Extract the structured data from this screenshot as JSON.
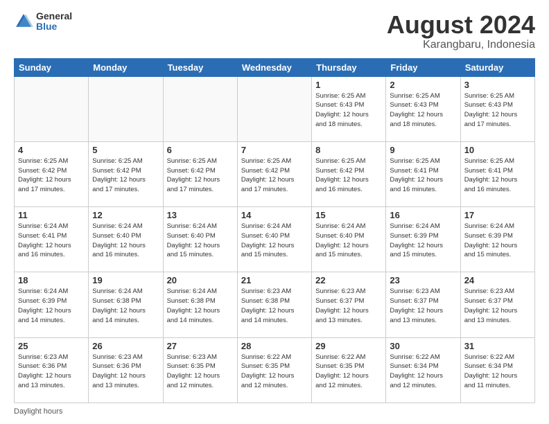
{
  "logo": {
    "line1": "General",
    "line2": "Blue"
  },
  "title": "August 2024",
  "subtitle": "Karangbaru, Indonesia",
  "days_header": [
    "Sunday",
    "Monday",
    "Tuesday",
    "Wednesday",
    "Thursday",
    "Friday",
    "Saturday"
  ],
  "footer": "Daylight hours",
  "weeks": [
    [
      {
        "num": "",
        "info": ""
      },
      {
        "num": "",
        "info": ""
      },
      {
        "num": "",
        "info": ""
      },
      {
        "num": "",
        "info": ""
      },
      {
        "num": "1",
        "info": "Sunrise: 6:25 AM\nSunset: 6:43 PM\nDaylight: 12 hours\nand 18 minutes."
      },
      {
        "num": "2",
        "info": "Sunrise: 6:25 AM\nSunset: 6:43 PM\nDaylight: 12 hours\nand 18 minutes."
      },
      {
        "num": "3",
        "info": "Sunrise: 6:25 AM\nSunset: 6:43 PM\nDaylight: 12 hours\nand 17 minutes."
      }
    ],
    [
      {
        "num": "4",
        "info": "Sunrise: 6:25 AM\nSunset: 6:42 PM\nDaylight: 12 hours\nand 17 minutes."
      },
      {
        "num": "5",
        "info": "Sunrise: 6:25 AM\nSunset: 6:42 PM\nDaylight: 12 hours\nand 17 minutes."
      },
      {
        "num": "6",
        "info": "Sunrise: 6:25 AM\nSunset: 6:42 PM\nDaylight: 12 hours\nand 17 minutes."
      },
      {
        "num": "7",
        "info": "Sunrise: 6:25 AM\nSunset: 6:42 PM\nDaylight: 12 hours\nand 17 minutes."
      },
      {
        "num": "8",
        "info": "Sunrise: 6:25 AM\nSunset: 6:42 PM\nDaylight: 12 hours\nand 16 minutes."
      },
      {
        "num": "9",
        "info": "Sunrise: 6:25 AM\nSunset: 6:41 PM\nDaylight: 12 hours\nand 16 minutes."
      },
      {
        "num": "10",
        "info": "Sunrise: 6:25 AM\nSunset: 6:41 PM\nDaylight: 12 hours\nand 16 minutes."
      }
    ],
    [
      {
        "num": "11",
        "info": "Sunrise: 6:24 AM\nSunset: 6:41 PM\nDaylight: 12 hours\nand 16 minutes."
      },
      {
        "num": "12",
        "info": "Sunrise: 6:24 AM\nSunset: 6:40 PM\nDaylight: 12 hours\nand 16 minutes."
      },
      {
        "num": "13",
        "info": "Sunrise: 6:24 AM\nSunset: 6:40 PM\nDaylight: 12 hours\nand 15 minutes."
      },
      {
        "num": "14",
        "info": "Sunrise: 6:24 AM\nSunset: 6:40 PM\nDaylight: 12 hours\nand 15 minutes."
      },
      {
        "num": "15",
        "info": "Sunrise: 6:24 AM\nSunset: 6:40 PM\nDaylight: 12 hours\nand 15 minutes."
      },
      {
        "num": "16",
        "info": "Sunrise: 6:24 AM\nSunset: 6:39 PM\nDaylight: 12 hours\nand 15 minutes."
      },
      {
        "num": "17",
        "info": "Sunrise: 6:24 AM\nSunset: 6:39 PM\nDaylight: 12 hours\nand 15 minutes."
      }
    ],
    [
      {
        "num": "18",
        "info": "Sunrise: 6:24 AM\nSunset: 6:39 PM\nDaylight: 12 hours\nand 14 minutes."
      },
      {
        "num": "19",
        "info": "Sunrise: 6:24 AM\nSunset: 6:38 PM\nDaylight: 12 hours\nand 14 minutes."
      },
      {
        "num": "20",
        "info": "Sunrise: 6:24 AM\nSunset: 6:38 PM\nDaylight: 12 hours\nand 14 minutes."
      },
      {
        "num": "21",
        "info": "Sunrise: 6:23 AM\nSunset: 6:38 PM\nDaylight: 12 hours\nand 14 minutes."
      },
      {
        "num": "22",
        "info": "Sunrise: 6:23 AM\nSunset: 6:37 PM\nDaylight: 12 hours\nand 13 minutes."
      },
      {
        "num": "23",
        "info": "Sunrise: 6:23 AM\nSunset: 6:37 PM\nDaylight: 12 hours\nand 13 minutes."
      },
      {
        "num": "24",
        "info": "Sunrise: 6:23 AM\nSunset: 6:37 PM\nDaylight: 12 hours\nand 13 minutes."
      }
    ],
    [
      {
        "num": "25",
        "info": "Sunrise: 6:23 AM\nSunset: 6:36 PM\nDaylight: 12 hours\nand 13 minutes."
      },
      {
        "num": "26",
        "info": "Sunrise: 6:23 AM\nSunset: 6:36 PM\nDaylight: 12 hours\nand 13 minutes."
      },
      {
        "num": "27",
        "info": "Sunrise: 6:23 AM\nSunset: 6:35 PM\nDaylight: 12 hours\nand 12 minutes."
      },
      {
        "num": "28",
        "info": "Sunrise: 6:22 AM\nSunset: 6:35 PM\nDaylight: 12 hours\nand 12 minutes."
      },
      {
        "num": "29",
        "info": "Sunrise: 6:22 AM\nSunset: 6:35 PM\nDaylight: 12 hours\nand 12 minutes."
      },
      {
        "num": "30",
        "info": "Sunrise: 6:22 AM\nSunset: 6:34 PM\nDaylight: 12 hours\nand 12 minutes."
      },
      {
        "num": "31",
        "info": "Sunrise: 6:22 AM\nSunset: 6:34 PM\nDaylight: 12 hours\nand 11 minutes."
      }
    ]
  ]
}
